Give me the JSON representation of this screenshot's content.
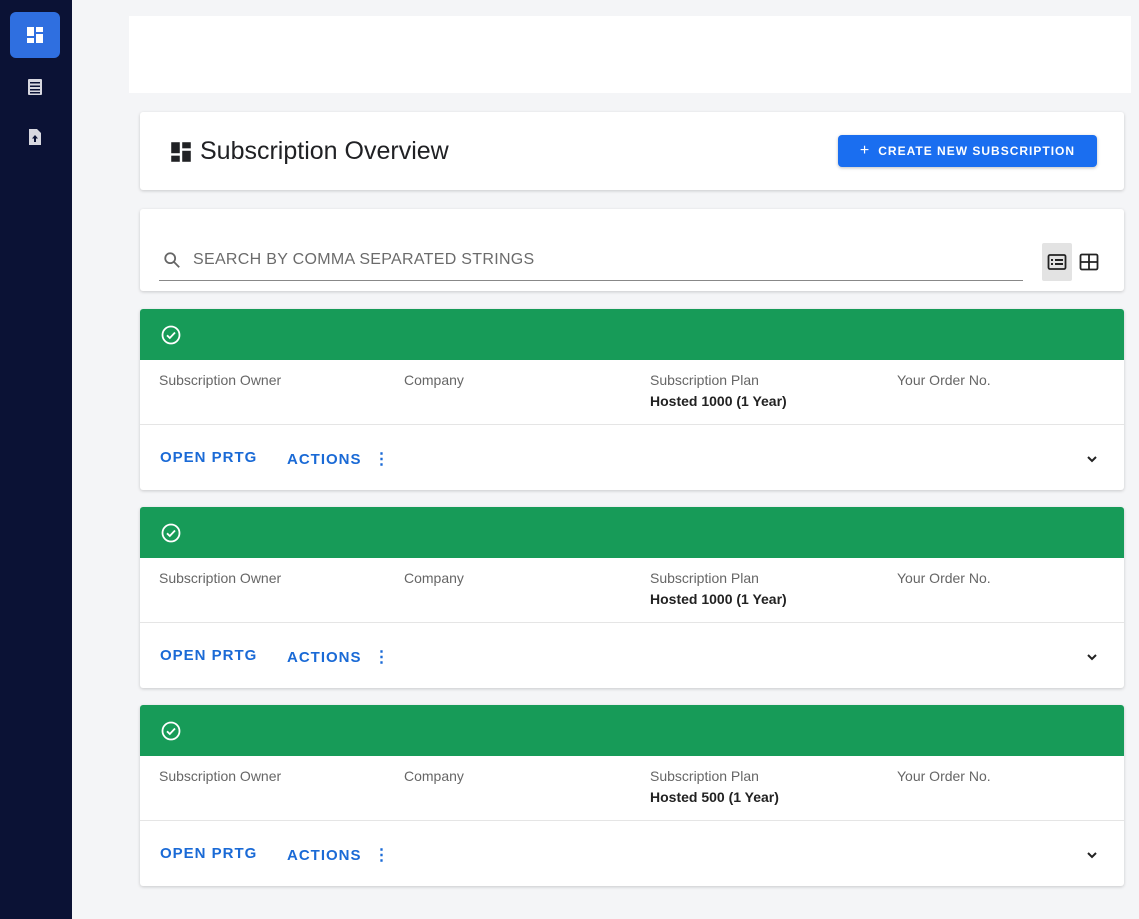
{
  "sidebar": {
    "items": [
      {
        "icon": "dashboard-icon",
        "active": true
      },
      {
        "icon": "list-icon",
        "active": false
      },
      {
        "icon": "document-upload-icon",
        "active": false
      }
    ]
  },
  "header": {
    "title": "Subscription Overview",
    "create_button": "CREATE NEW SUBSCRIPTION",
    "create_icon": "+"
  },
  "search": {
    "placeholder": "SEARCH BY COMMA SEPARATED STRINGS",
    "value": ""
  },
  "colors": {
    "accent": "#1a6ef0",
    "status_active": "#179b58",
    "sidebar_bg": "#0b1235"
  },
  "subscriptions": [
    {
      "labels": {
        "owner": "Subscription Owner",
        "company": "Company",
        "plan": "Subscription Plan",
        "order": "Your Order No."
      },
      "plan": "Hosted 1000 (1 Year)",
      "open_label": "OPEN PRTG",
      "actions_label": "ACTIONS"
    },
    {
      "labels": {
        "owner": "Subscription Owner",
        "company": "Company",
        "plan": "Subscription Plan",
        "order": "Your Order No."
      },
      "plan": "Hosted 1000 (1 Year)",
      "open_label": "OPEN PRTG",
      "actions_label": "ACTIONS"
    },
    {
      "labels": {
        "owner": "Subscription Owner",
        "company": "Company",
        "plan": "Subscription Plan",
        "order": "Your Order No."
      },
      "plan": "Hosted 500 (1 Year)",
      "open_label": "OPEN PRTG",
      "actions_label": "ACTIONS"
    }
  ]
}
